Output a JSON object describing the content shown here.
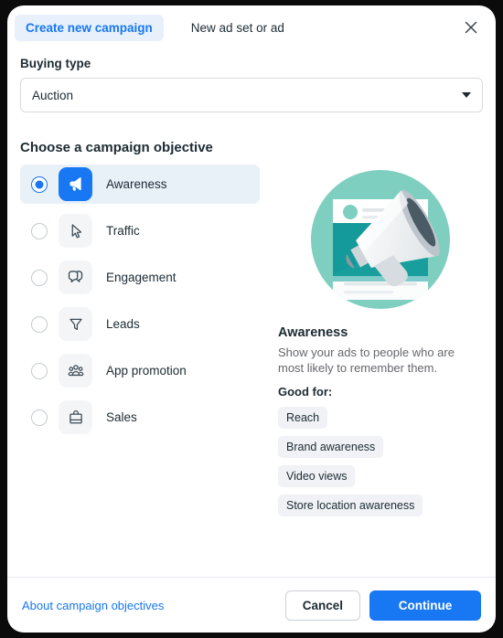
{
  "header": {
    "tab_active": "Create new campaign",
    "tab_inactive": "New ad set or ad",
    "close_icon": "close-icon"
  },
  "buying_type": {
    "label": "Buying type",
    "value": "Auction",
    "caret_icon": "chevron-down-icon"
  },
  "objective_section": {
    "title": "Choose a campaign objective",
    "items": [
      {
        "label": "Awareness",
        "icon": "megaphone-icon",
        "selected": true
      },
      {
        "label": "Traffic",
        "icon": "cursor-pointer-icon",
        "selected": false
      },
      {
        "label": "Engagement",
        "icon": "speech-bubbles-icon",
        "selected": false
      },
      {
        "label": "Leads",
        "icon": "funnel-icon",
        "selected": false
      },
      {
        "label": "App promotion",
        "icon": "people-group-icon",
        "selected": false
      },
      {
        "label": "Sales",
        "icon": "shopping-bag-icon",
        "selected": false
      }
    ]
  },
  "detail": {
    "illustration_icon": "megaphone-illustration",
    "title": "Awareness",
    "description": "Show your ads to people who are most likely to remember them.",
    "good_for_label": "Good for:",
    "chips": [
      "Reach",
      "Brand awareness",
      "Video views",
      "Store location awareness"
    ]
  },
  "footer": {
    "link": "About campaign objectives",
    "cancel": "Cancel",
    "continue": "Continue"
  },
  "colors": {
    "accent": "#1877f2",
    "selected_row": "#e8f0f8",
    "tile_bg": "#f4f5f7",
    "chip_bg": "#f0f2f5",
    "text": "#1c2b33",
    "muted_text": "#65676b",
    "illustration_teal": "#7fcfc0",
    "illustration_deep_teal": "#149a9a"
  }
}
